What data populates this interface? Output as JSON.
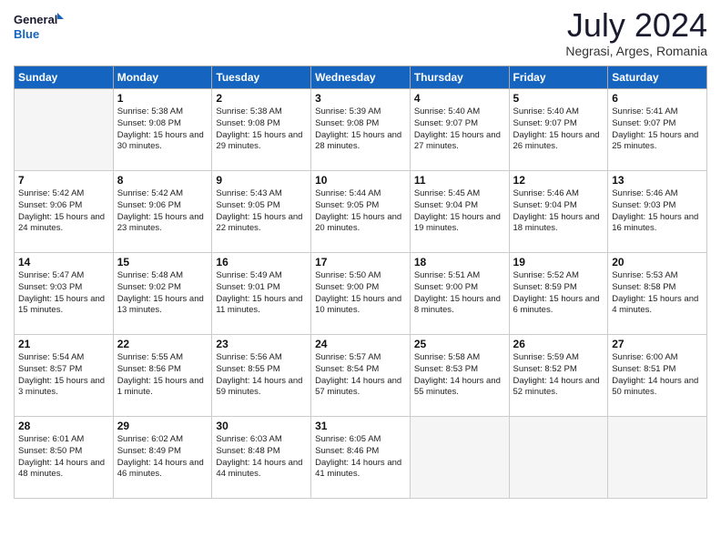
{
  "logo": {
    "line1": "General",
    "line2": "Blue"
  },
  "title": "July 2024",
  "location": "Negrasi, Arges, Romania",
  "days_header": [
    "Sunday",
    "Monday",
    "Tuesday",
    "Wednesday",
    "Thursday",
    "Friday",
    "Saturday"
  ],
  "weeks": [
    [
      {
        "num": "",
        "sunrise": "",
        "sunset": "",
        "daylight": ""
      },
      {
        "num": "1",
        "sunrise": "5:38 AM",
        "sunset": "9:08 PM",
        "daylight": "15 hours and 30 minutes."
      },
      {
        "num": "2",
        "sunrise": "5:38 AM",
        "sunset": "9:08 PM",
        "daylight": "15 hours and 29 minutes."
      },
      {
        "num": "3",
        "sunrise": "5:39 AM",
        "sunset": "9:08 PM",
        "daylight": "15 hours and 28 minutes."
      },
      {
        "num": "4",
        "sunrise": "5:40 AM",
        "sunset": "9:07 PM",
        "daylight": "15 hours and 27 minutes."
      },
      {
        "num": "5",
        "sunrise": "5:40 AM",
        "sunset": "9:07 PM",
        "daylight": "15 hours and 26 minutes."
      },
      {
        "num": "6",
        "sunrise": "5:41 AM",
        "sunset": "9:07 PM",
        "daylight": "15 hours and 25 minutes."
      }
    ],
    [
      {
        "num": "7",
        "sunrise": "5:42 AM",
        "sunset": "9:06 PM",
        "daylight": "15 hours and 24 minutes."
      },
      {
        "num": "8",
        "sunrise": "5:42 AM",
        "sunset": "9:06 PM",
        "daylight": "15 hours and 23 minutes."
      },
      {
        "num": "9",
        "sunrise": "5:43 AM",
        "sunset": "9:05 PM",
        "daylight": "15 hours and 22 minutes."
      },
      {
        "num": "10",
        "sunrise": "5:44 AM",
        "sunset": "9:05 PM",
        "daylight": "15 hours and 20 minutes."
      },
      {
        "num": "11",
        "sunrise": "5:45 AM",
        "sunset": "9:04 PM",
        "daylight": "15 hours and 19 minutes."
      },
      {
        "num": "12",
        "sunrise": "5:46 AM",
        "sunset": "9:04 PM",
        "daylight": "15 hours and 18 minutes."
      },
      {
        "num": "13",
        "sunrise": "5:46 AM",
        "sunset": "9:03 PM",
        "daylight": "15 hours and 16 minutes."
      }
    ],
    [
      {
        "num": "14",
        "sunrise": "5:47 AM",
        "sunset": "9:03 PM",
        "daylight": "15 hours and 15 minutes."
      },
      {
        "num": "15",
        "sunrise": "5:48 AM",
        "sunset": "9:02 PM",
        "daylight": "15 hours and 13 minutes."
      },
      {
        "num": "16",
        "sunrise": "5:49 AM",
        "sunset": "9:01 PM",
        "daylight": "15 hours and 11 minutes."
      },
      {
        "num": "17",
        "sunrise": "5:50 AM",
        "sunset": "9:00 PM",
        "daylight": "15 hours and 10 minutes."
      },
      {
        "num": "18",
        "sunrise": "5:51 AM",
        "sunset": "9:00 PM",
        "daylight": "15 hours and 8 minutes."
      },
      {
        "num": "19",
        "sunrise": "5:52 AM",
        "sunset": "8:59 PM",
        "daylight": "15 hours and 6 minutes."
      },
      {
        "num": "20",
        "sunrise": "5:53 AM",
        "sunset": "8:58 PM",
        "daylight": "15 hours and 4 minutes."
      }
    ],
    [
      {
        "num": "21",
        "sunrise": "5:54 AM",
        "sunset": "8:57 PM",
        "daylight": "15 hours and 3 minutes."
      },
      {
        "num": "22",
        "sunrise": "5:55 AM",
        "sunset": "8:56 PM",
        "daylight": "15 hours and 1 minute."
      },
      {
        "num": "23",
        "sunrise": "5:56 AM",
        "sunset": "8:55 PM",
        "daylight": "14 hours and 59 minutes."
      },
      {
        "num": "24",
        "sunrise": "5:57 AM",
        "sunset": "8:54 PM",
        "daylight": "14 hours and 57 minutes."
      },
      {
        "num": "25",
        "sunrise": "5:58 AM",
        "sunset": "8:53 PM",
        "daylight": "14 hours and 55 minutes."
      },
      {
        "num": "26",
        "sunrise": "5:59 AM",
        "sunset": "8:52 PM",
        "daylight": "14 hours and 52 minutes."
      },
      {
        "num": "27",
        "sunrise": "6:00 AM",
        "sunset": "8:51 PM",
        "daylight": "14 hours and 50 minutes."
      }
    ],
    [
      {
        "num": "28",
        "sunrise": "6:01 AM",
        "sunset": "8:50 PM",
        "daylight": "14 hours and 48 minutes."
      },
      {
        "num": "29",
        "sunrise": "6:02 AM",
        "sunset": "8:49 PM",
        "daylight": "14 hours and 46 minutes."
      },
      {
        "num": "30",
        "sunrise": "6:03 AM",
        "sunset": "8:48 PM",
        "daylight": "14 hours and 44 minutes."
      },
      {
        "num": "31",
        "sunrise": "6:05 AM",
        "sunset": "8:46 PM",
        "daylight": "14 hours and 41 minutes."
      },
      {
        "num": "",
        "sunrise": "",
        "sunset": "",
        "daylight": ""
      },
      {
        "num": "",
        "sunrise": "",
        "sunset": "",
        "daylight": ""
      },
      {
        "num": "",
        "sunrise": "",
        "sunset": "",
        "daylight": ""
      }
    ]
  ]
}
